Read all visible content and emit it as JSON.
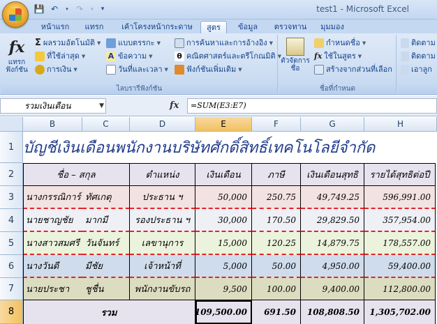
{
  "window": {
    "title": "test1 - Microsoft Excel"
  },
  "tabs": [
    "หน้าแรก",
    "แทรก",
    "เค้าโครงหน้ากระดาษ",
    "สูตร",
    "ข้อมูล",
    "ตรวจทาน",
    "มุมมอง"
  ],
  "active_tab": "สูตร",
  "ribbon": {
    "insert_function": {
      "icon": "fx",
      "label_1": "แทรก",
      "label_2": "ฟังก์ชัน"
    },
    "library": {
      "autosum": "ผลรวมอัตโนมัติ",
      "recent": "ที่ใช้ล่าสุด",
      "financial": "การเงิน",
      "logical": "แบบตรรกะ",
      "text": "ข้อความ",
      "datetime": "วันที่และเวลา",
      "lookup": "การค้นหาและการอ้างอิง",
      "math": "คณิตศาสตร์และตรีโกณมิติ",
      "more": "ฟังก์ชันเพิ่มเติม",
      "group_label": "ไลบรารีฟังก์ชัน"
    },
    "names": {
      "manager_1": "ตัวจัดการ",
      "manager_2": "ชื่อ",
      "define": "กำหนดชื่อ",
      "use_in_formula": "ใช้ในสูตร",
      "create": "สร้างจากส่วนที่เลือก",
      "group_label": "ชื่อที่กำหนด"
    },
    "audit": {
      "trace1": "ติดตาม",
      "trace2": "ติดตาม",
      "remove": "เอาลูก"
    }
  },
  "formula_bar": {
    "name_box": "รวมเงินเดือน",
    "fx": "fx",
    "formula": "=SUM(E3:E7)"
  },
  "columns": [
    "B",
    "C",
    "D",
    "E",
    "F",
    "G",
    "H"
  ],
  "selected_column": "E",
  "rows": [
    "1",
    "2",
    "3",
    "4",
    "5",
    "6",
    "7",
    "8"
  ],
  "selected_row": "8",
  "sheet": {
    "title": "บัญชีเงินเดือนพนักงานบริษัทศักดิ์สิทธิ์เทคโนโลยีจำกัด",
    "headers": [
      "ชื่อ – สกุล",
      "ตำแหน่ง",
      "เงินเดือน",
      "ภาษี",
      "เงินเดือนสุทธิ",
      "รายได้สุทธิต่อปี"
    ],
    "records": [
      {
        "first": "นางกรรณิการ์",
        "last": "ทัศเกตุ",
        "position": "ประธาน ฯ",
        "salary": "50,000",
        "tax": "250.75",
        "net": "49,749.25",
        "annual": "596,991.00"
      },
      {
        "first": "นายชาญชัย",
        "last": "มากมี",
        "position": "รองประธาน ฯ",
        "salary": "30,000",
        "tax": "170.50",
        "net": "29,829.50",
        "annual": "357,954.00"
      },
      {
        "first": "นางสาวสมศรี",
        "last": "วันจันทร์",
        "position": "เลขานุการ",
        "salary": "15,000",
        "tax": "120.25",
        "net": "14,879.75",
        "annual": "178,557.00"
      },
      {
        "first": "นางวันดี",
        "last": "มีชัย",
        "position": "เจ้าหน้าที่",
        "salary": "5,000",
        "tax": "50.00",
        "net": "4,950.00",
        "annual": "59,400.00"
      },
      {
        "first": "นายประชา",
        "last": "ชูชื่น",
        "position": "พนักงานขับรถ",
        "salary": "9,500",
        "tax": "100.00",
        "net": "9,400.00",
        "annual": "112,800.00"
      }
    ],
    "total": {
      "label": "รวม",
      "salary": "109,500.00",
      "tax": "691.50",
      "net": "108,808.50",
      "annual": "1,305,702.00"
    }
  }
}
